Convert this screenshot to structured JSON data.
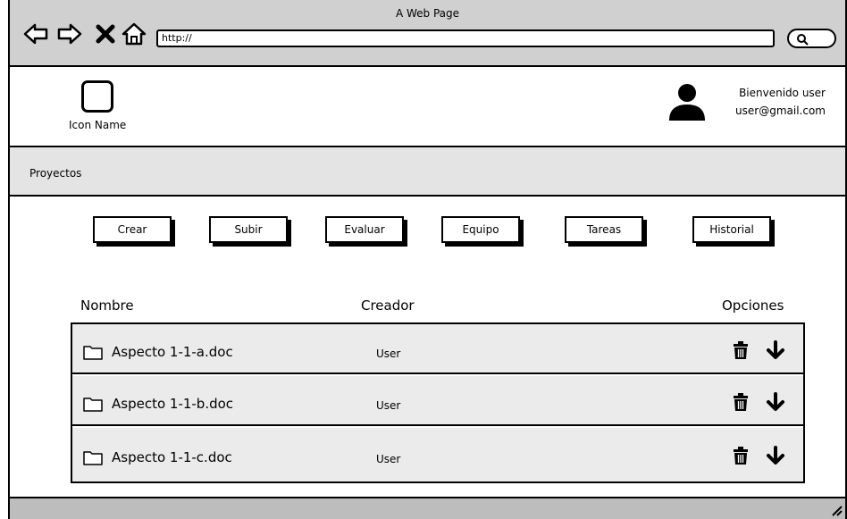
{
  "window": {
    "title": "A Web Page"
  },
  "browser": {
    "url": "http://",
    "icons": [
      "back-arrow-icon",
      "forward-arrow-icon",
      "close-x-icon",
      "home-icon",
      "search-icon"
    ]
  },
  "header": {
    "logo_label": "Icon Name",
    "user_greeting": "Bienvenido user",
    "user_email": "user@gmail.com"
  },
  "breadcrumb": {
    "label": "Proyectos"
  },
  "toolbar": {
    "buttons": [
      {
        "label": "Crear"
      },
      {
        "label": "Subir"
      },
      {
        "label": "Evaluar"
      },
      {
        "label": "Equipo"
      },
      {
        "label": "Tareas"
      },
      {
        "label": "Historial"
      }
    ]
  },
  "table": {
    "headers": {
      "name": "Nombre",
      "creator": "Creador",
      "options": "Opciones"
    },
    "rows": [
      {
        "name": "Aspecto 1-1-a.doc",
        "creator": "User"
      },
      {
        "name": "Aspecto 1-1-b.doc",
        "creator": "User"
      },
      {
        "name": "Aspecto 1-1-c.doc",
        "creator": "User"
      }
    ]
  },
  "colors": {
    "chrome": "#d0d0d0",
    "subbar": "#e4e4e4",
    "row": "#ebebeb",
    "statusbar": "#bdbdbd"
  }
}
